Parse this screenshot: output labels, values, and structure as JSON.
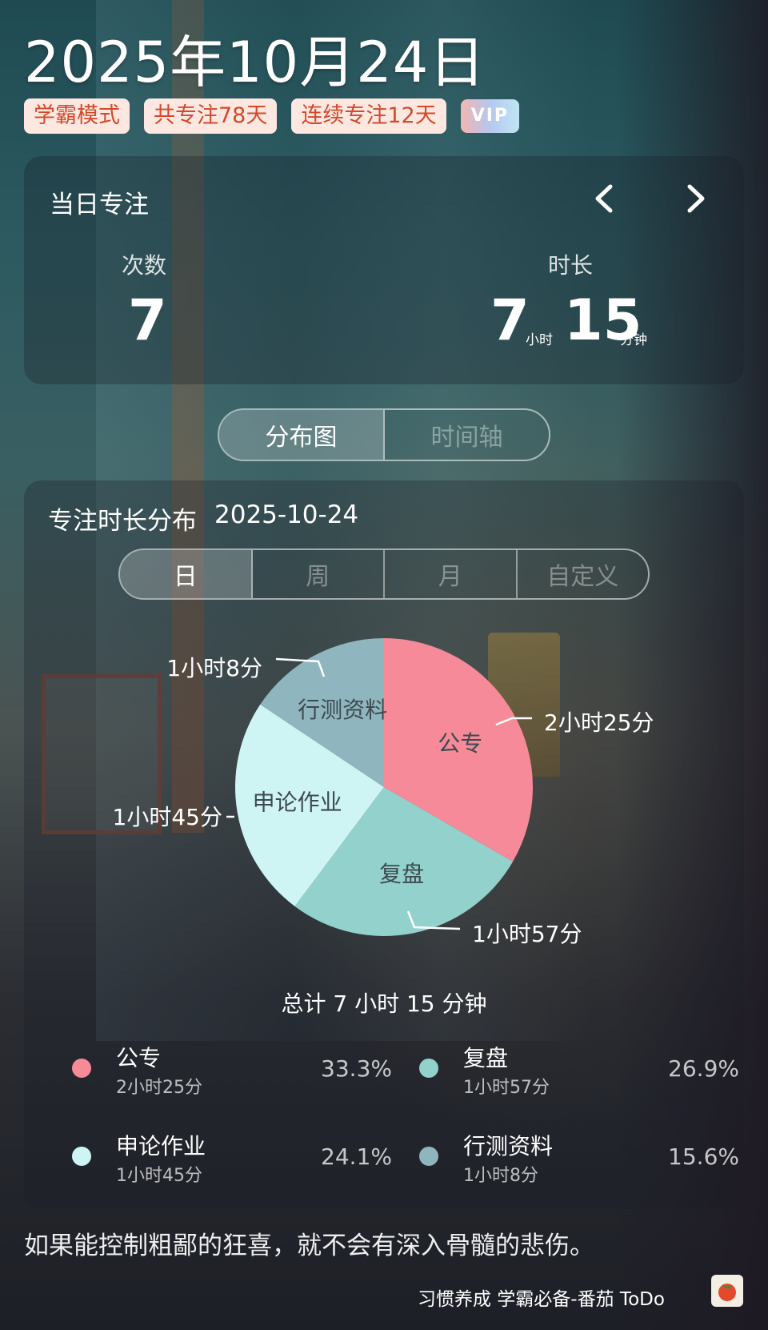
{
  "header": {
    "date": "2025年10月24日",
    "tags": [
      "学霸模式",
      "共专注78天",
      "连续专注12天"
    ],
    "vip": "VIP"
  },
  "daily_focus": {
    "title": "当日专注",
    "count_label": "次数",
    "count_value": "7",
    "duration_label": "时长",
    "hours": "7",
    "hours_unit": "小时",
    "minutes": "15",
    "minutes_unit": "分钟"
  },
  "view_toggle": {
    "options": [
      "分布图",
      "时间轴"
    ],
    "active": "分布图"
  },
  "distribution": {
    "title": "专注时长分布",
    "date": "2025-10-24",
    "ranges": [
      "日",
      "周",
      "月",
      "自定义"
    ],
    "active_range": "日",
    "total_text": "总计 7 小时 15 分钟"
  },
  "chart_data": {
    "type": "pie",
    "slices": [
      {
        "name": "公专",
        "label": "2小时25分",
        "minutes": 145,
        "percent": "33.3%",
        "color": "#f68a98"
      },
      {
        "name": "复盘",
        "label": "1小时57分",
        "minutes": 117,
        "percent": "26.9%",
        "color": "#93d1cd"
      },
      {
        "name": "申论作业",
        "label": "1小时45分",
        "minutes": 105,
        "percent": "24.1%",
        "color": "#cff4f4"
      },
      {
        "name": "行测资料",
        "label": "1小时8分",
        "minutes": 68,
        "percent": "15.6%",
        "color": "#8fb6bf"
      }
    ]
  },
  "quote": "如果能控制粗鄙的狂喜，就不会有深入骨髓的悲伤。",
  "footer": {
    "text": "习惯养成 学霸必备-番茄 ToDo",
    "icon": "tomato-icon"
  }
}
